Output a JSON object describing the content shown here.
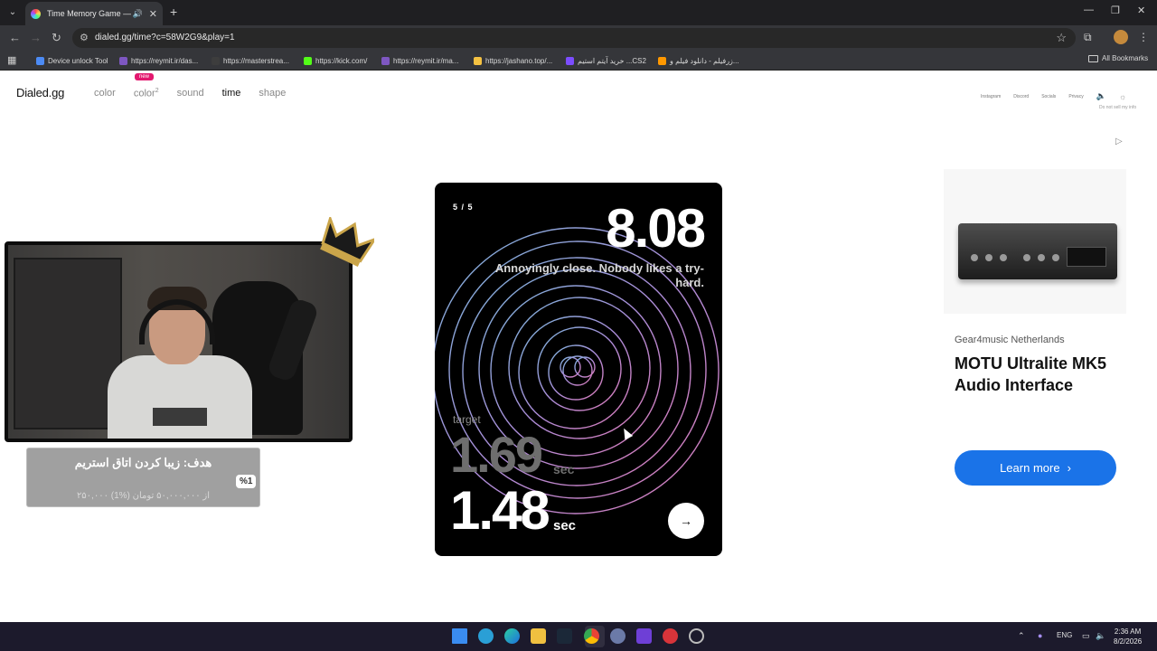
{
  "browser": {
    "tab_title": "Time Memory Game — Ho",
    "url": "dialed.gg/time?c=58W2G9&play=1",
    "bookmarks": [
      {
        "label": "Device unlock Tool",
        "color": "#4c8bf5"
      },
      {
        "label": "https://reymit.ir/das...",
        "color": "#7e57c2"
      },
      {
        "label": "https://masterstrea...",
        "color": "#ffffff"
      },
      {
        "label": "https://kick.com/",
        "color": "#53fc18"
      },
      {
        "label": "https://reymit.ir/ma...",
        "color": "#7e57c2"
      },
      {
        "label": "https://jashano.top/...",
        "color": "#f5c242"
      },
      {
        "label": "خرید آیتم استیم ...CS2",
        "color": "#7c4dff"
      },
      {
        "label": "زرفیلم - دانلود فیلم و...",
        "color": "#ff9800"
      }
    ],
    "all_bookmarks": "All Bookmarks"
  },
  "site": {
    "logo": "Dialed.gg",
    "nav": [
      "color",
      "color",
      "sound",
      "time",
      "shape"
    ],
    "nav_sup": "2",
    "new_badge": "new",
    "links": [
      "Instagram",
      "Discord",
      "Socials",
      "Privacy"
    ],
    "do_not_sell": "Do not sell my info"
  },
  "game": {
    "progress": "5 / 5",
    "score": "8.08",
    "comment": "Annoyingly close. Nobody likes a try-hard.",
    "target_label": "target",
    "target_value": "1.69",
    "unit": "sec",
    "your_value": "1.48"
  },
  "overlay": {
    "donation_title": "هدف: زیبا کردن اتاق استریم",
    "donation_percent": "%1",
    "donation_sub": "۲۵۰,۰۰۰ از ۵۰,۰۰۰,۰۰۰ تومان (%1)"
  },
  "ad": {
    "advertiser": "Gear4music Netherlands",
    "headline": "MOTU Ultralite MK5 Audio Interface",
    "cta": "Learn more"
  },
  "taskbar": {
    "lang": "ENG",
    "time": "2:36 AM",
    "date": "8/2/2026"
  }
}
